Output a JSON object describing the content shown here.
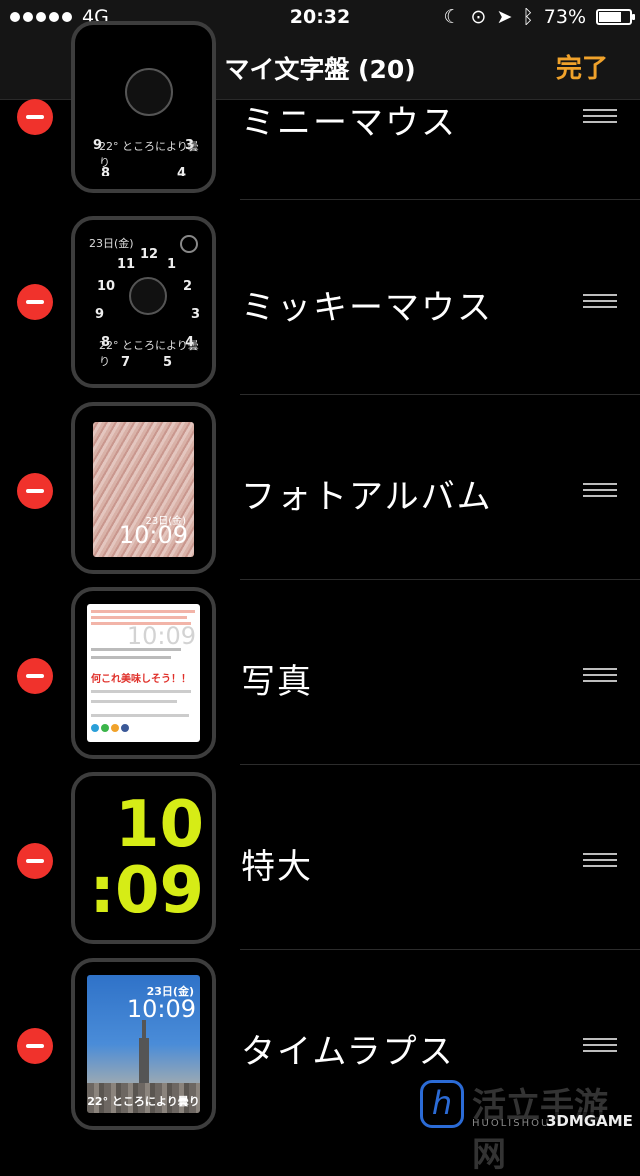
{
  "status_bar": {
    "carrier": "4G",
    "time": "20:32",
    "battery_percent": "73%",
    "battery_level": 0.73,
    "icons": [
      "moon-icon",
      "rotation-lock-icon",
      "location-arrow-icon",
      "bluetooth-icon"
    ]
  },
  "nav": {
    "title": "マイ文字盤 (20)",
    "done_label": "完了",
    "accent_color": "#f0a22b"
  },
  "faces": [
    {
      "label": "ミニーマウス",
      "complication": "22° ところにより曇り",
      "numbers": [
        "9",
        "3",
        "8",
        "4"
      ]
    },
    {
      "label": "ミッキーマウス",
      "date": "23日(金)",
      "complication": "22° ところにより曇り",
      "numbers": [
        "12",
        "11",
        "1",
        "10",
        "2",
        "9",
        "3",
        "8",
        "4",
        "7",
        "5"
      ]
    },
    {
      "label": "フォトアルバム",
      "date": "23日(金)",
      "time": "10:09"
    },
    {
      "label": "写真",
      "time": "10:09",
      "headline": "何これ美味しそう！！"
    },
    {
      "label": "特大",
      "hours": "10",
      "minutes": ":09",
      "digit_color": "#d6ec16"
    },
    {
      "label": "タイムラプス",
      "date": "23日(金)",
      "time": "10:09",
      "complication": "22° ところにより曇り"
    }
  ],
  "watermark": {
    "logo_letter": "h",
    "brand_cn": "活立手游网",
    "brand_en": "HUOLISHOU",
    "brand_game": "3DMGAME"
  },
  "colors": {
    "delete": "#f0322c",
    "background": "#000000"
  }
}
